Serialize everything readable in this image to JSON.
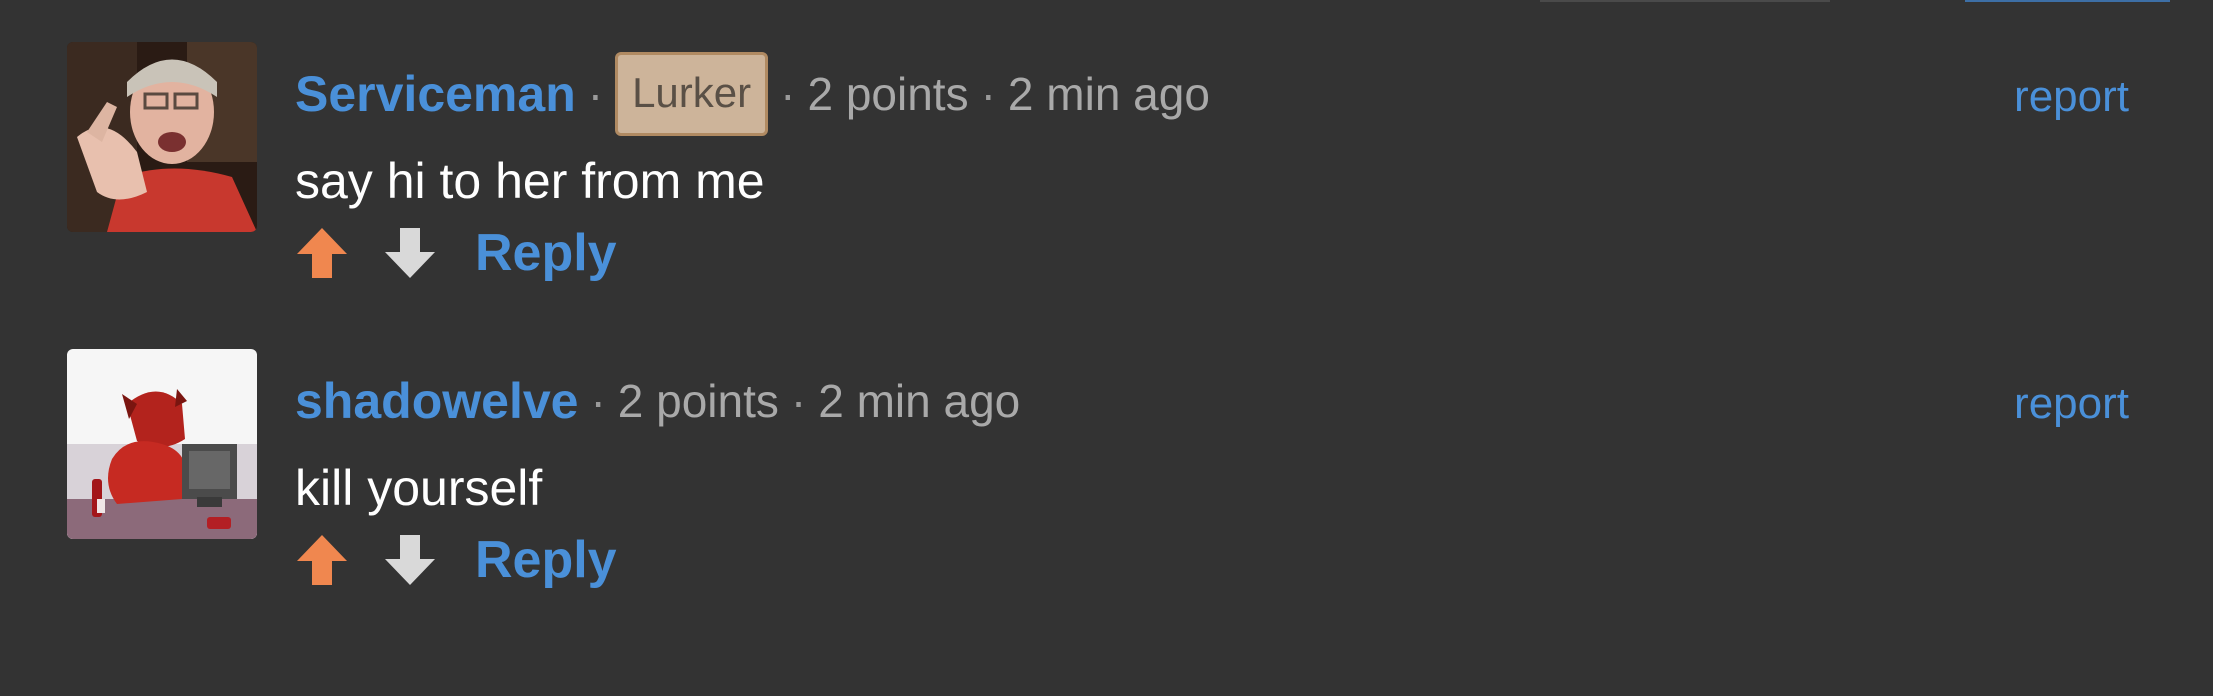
{
  "comments": [
    {
      "username": "Serviceman",
      "separator": "·",
      "badge": "Lurker",
      "points": "2 points",
      "time": "2 min ago",
      "report_label": "report",
      "text": "say hi to her from me",
      "reply_label": "Reply"
    },
    {
      "username": "shadowelve",
      "separator": "·",
      "points": "2 points",
      "time": "2 min ago",
      "report_label": "report",
      "text": "kill yourself",
      "reply_label": "Reply"
    }
  ],
  "colors": {
    "background": "#333333",
    "username": "#4a90d9",
    "meta": "#a9a9a9",
    "badge_bg": "#cdb49a",
    "upvote": "#f0874f",
    "downvote": "#d9d9d9",
    "text": "#ffffff"
  },
  "icons": {
    "upvote": "arrow-up-icon",
    "downvote": "arrow-down-icon"
  }
}
